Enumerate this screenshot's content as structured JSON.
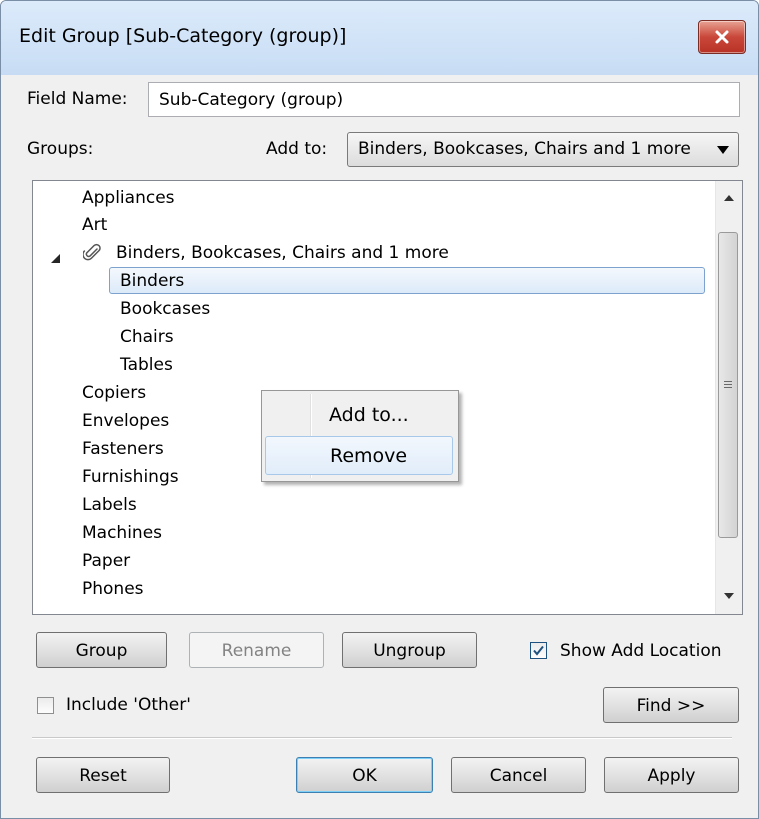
{
  "window": {
    "title": "Edit Group [Sub-Category (group)]"
  },
  "field_name": {
    "label": "Field Name:",
    "value": "Sub-Category (group)"
  },
  "groups": {
    "label": "Groups:"
  },
  "add_to": {
    "label": "Add to:",
    "selected": "Binders, Bookcases, Chairs and 1 more"
  },
  "tree": {
    "items": [
      "Appliances",
      "Art",
      "Binders, Bookcases, Chairs and 1 more",
      "Binders",
      "Bookcases",
      "Chairs",
      "Tables",
      "Copiers",
      "Envelopes",
      "Fasteners",
      "Furnishings",
      "Labels",
      "Machines",
      "Paper",
      "Phones"
    ]
  },
  "context_menu": {
    "items": [
      "Add to...",
      "Remove"
    ]
  },
  "buttons": {
    "group": "Group",
    "rename": "Rename",
    "ungroup": "Ungroup",
    "find": "Find >>",
    "reset": "Reset",
    "ok": "OK",
    "cancel": "Cancel",
    "apply": "Apply"
  },
  "checkboxes": {
    "show_add_location": {
      "label": "Show Add Location",
      "checked": true
    },
    "include_other": {
      "label": "Include 'Other'",
      "checked": false
    }
  },
  "icons": {
    "close": "close-icon",
    "group_clip": "paperclip-icon"
  },
  "colors": {
    "title_bar": "#c7dcf4",
    "close_button": "#c9473a",
    "selection": "#dceaf9"
  }
}
